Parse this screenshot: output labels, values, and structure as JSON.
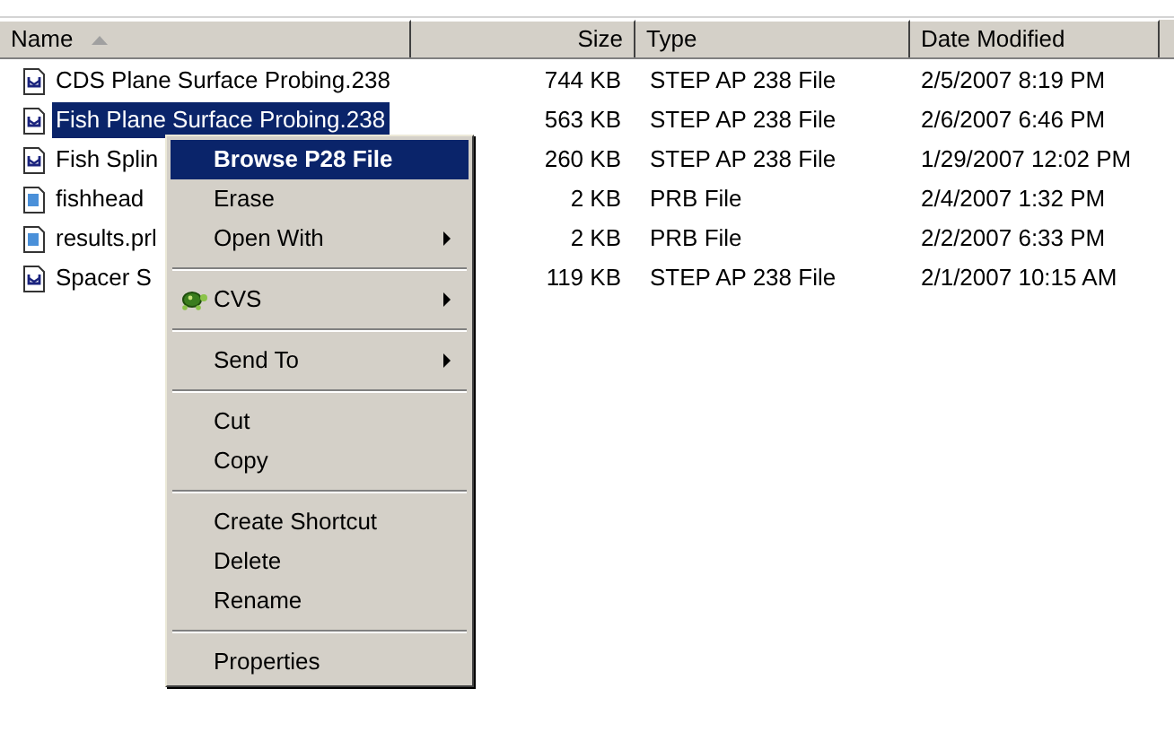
{
  "columns": [
    {
      "label": "Name",
      "sorted": true
    },
    {
      "label": "Size",
      "sorted": false
    },
    {
      "label": "Type",
      "sorted": false
    },
    {
      "label": "Date Modified",
      "sorted": false
    }
  ],
  "rows": [
    {
      "name": "CDS Plane Surface Probing.238",
      "size": "744 KB",
      "type": "STEP AP 238 File",
      "date": "2/5/2007 8:19 PM",
      "selected": false,
      "kind": "step"
    },
    {
      "name": "Fish Plane Surface Probing.238",
      "size": "563 KB",
      "type": "STEP AP 238 File",
      "date": "2/6/2007 6:46 PM",
      "selected": true,
      "kind": "step"
    },
    {
      "name": "Fish Splin",
      "size": "260 KB",
      "type": "STEP AP 238 File",
      "date": "1/29/2007 12:02 PM",
      "selected": false,
      "kind": "step"
    },
    {
      "name": "fishhead",
      "size": "2 KB",
      "type": "PRB File",
      "date": "2/4/2007 1:32 PM",
      "selected": false,
      "kind": "prb"
    },
    {
      "name": "results.prl",
      "size": "2 KB",
      "type": "PRB File",
      "date": "2/2/2007 6:33 PM",
      "selected": false,
      "kind": "prb"
    },
    {
      "name": "Spacer S",
      "size": "119 KB",
      "type": "STEP AP 238 File",
      "date": "2/1/2007 10:15 AM",
      "selected": false,
      "kind": "step"
    }
  ],
  "context_menu": [
    {
      "kind": "item",
      "label": "Browse P28 File",
      "selected": true,
      "default": true,
      "submenu": false
    },
    {
      "kind": "item",
      "label": "Erase",
      "selected": false,
      "default": false,
      "submenu": false
    },
    {
      "kind": "item",
      "label": "Open With",
      "selected": false,
      "default": false,
      "submenu": true
    },
    {
      "kind": "separator"
    },
    {
      "kind": "icon_item",
      "label": "CVS",
      "selected": false,
      "default": false,
      "submenu": true
    },
    {
      "kind": "separator"
    },
    {
      "kind": "item",
      "label": "Send To",
      "selected": false,
      "default": false,
      "submenu": true
    },
    {
      "kind": "separator"
    },
    {
      "kind": "item",
      "label": "Cut",
      "selected": false,
      "default": false,
      "submenu": false
    },
    {
      "kind": "item",
      "label": "Copy",
      "selected": false,
      "default": false,
      "submenu": false
    },
    {
      "kind": "separator"
    },
    {
      "kind": "item",
      "label": "Create Shortcut",
      "selected": false,
      "default": false,
      "submenu": false
    },
    {
      "kind": "item",
      "label": "Delete",
      "selected": false,
      "default": false,
      "submenu": false
    },
    {
      "kind": "item",
      "label": "Rename",
      "selected": false,
      "default": false,
      "submenu": false
    },
    {
      "kind": "separator"
    },
    {
      "kind": "item",
      "label": "Properties",
      "selected": false,
      "default": false,
      "submenu": false
    }
  ]
}
